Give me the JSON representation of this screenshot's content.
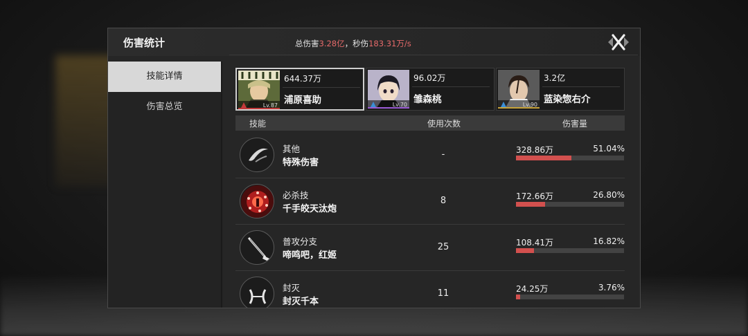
{
  "panel": {
    "title": "伤害统计",
    "summary_total_label": "总伤害",
    "summary_total_value": "3.28亿",
    "summary_sep": "，秒伤",
    "summary_dps_value": "183.31万/s"
  },
  "sidebar": {
    "tabs": [
      {
        "label": "技能详情",
        "active": true
      },
      {
        "label": "伤害总览",
        "active": false
      }
    ]
  },
  "characters": [
    {
      "damage": "644.37万",
      "name": "浦原喜助",
      "level": "Lv.87",
      "selected": true,
      "level_color": "#c23a3a"
    },
    {
      "damage": "96.02万",
      "name": "雏森桃",
      "level": "Lv.70",
      "selected": false,
      "level_color": "#9b5bd6"
    },
    {
      "damage": "3.2亿",
      "name": "蓝染惣右介",
      "level": "Lv.90",
      "selected": false,
      "level_color": "#c9a43a"
    }
  ],
  "table": {
    "headers": {
      "skill": "技能",
      "uses": "使用次数",
      "damage": "伤害量"
    },
    "rows": [
      {
        "type": "其他",
        "name": "特殊伤害",
        "uses": "-",
        "damage": "328.86万",
        "percent": "51.04%",
        "fraction": 0.5104,
        "icon": "slash-icon"
      },
      {
        "type": "必杀技",
        "name": "千手皎天汰炮",
        "uses": "8",
        "damage": "172.66万",
        "percent": "26.80%",
        "fraction": 0.268,
        "icon": "red-burst-icon"
      },
      {
        "type": "普攻分支",
        "name": "啼鸣吧，红姬",
        "uses": "25",
        "damage": "108.41万",
        "percent": "16.82%",
        "fraction": 0.1682,
        "icon": "cane-sword-icon"
      },
      {
        "type": "封灭",
        "name": "封灭千本",
        "uses": "11",
        "damage": "24.25万",
        "percent": "3.76%",
        "fraction": 0.0376,
        "icon": "swirl-icon"
      }
    ]
  },
  "colors": {
    "accent_red": "#e66a6a",
    "bar_fill": "#d2504e",
    "bar_track": "#434343"
  }
}
